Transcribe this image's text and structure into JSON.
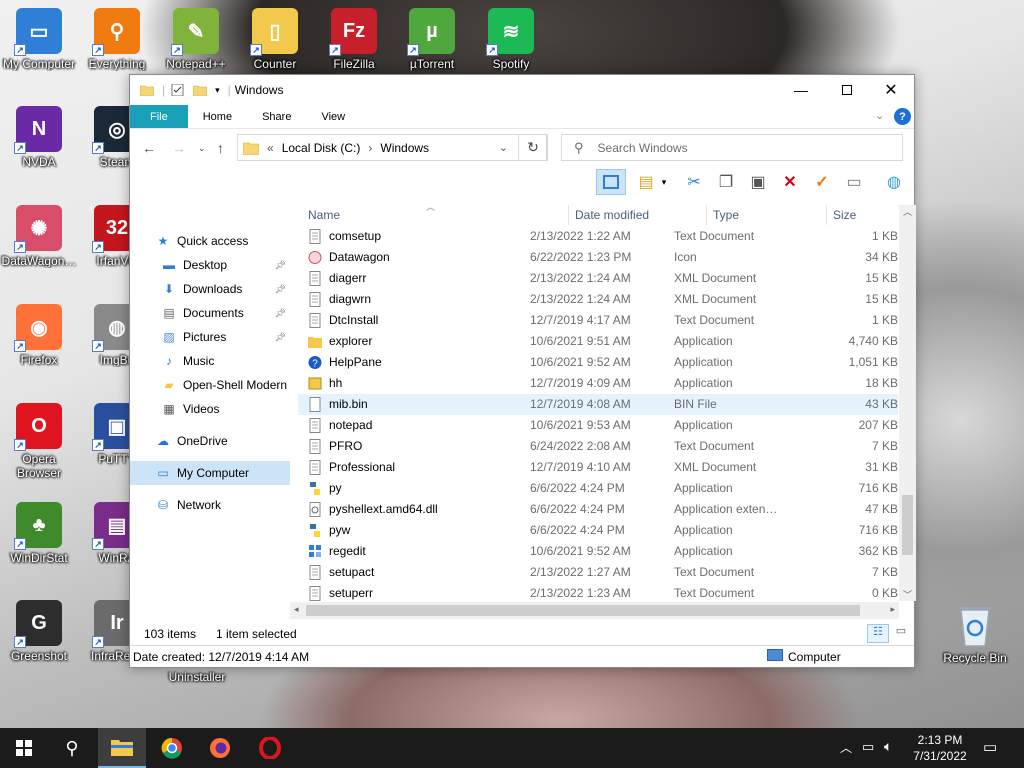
{
  "desktop": {
    "icons": [
      {
        "label": "My Computer",
        "color": "#2f7fd6",
        "glyph": "▭"
      },
      {
        "label": "Everything",
        "color": "#f07b10",
        "glyph": "⚲"
      },
      {
        "label": "Notepad++",
        "color": "#7fb33a",
        "glyph": "✎"
      },
      {
        "label": "Counter",
        "color": "#f2c94c",
        "glyph": "▯"
      },
      {
        "label": "FileZilla",
        "color": "#c8202a",
        "glyph": "Fz"
      },
      {
        "label": "µTorrent",
        "color": "#4fa83d",
        "glyph": "µ"
      },
      {
        "label": "Spotify",
        "color": "#1db954",
        "glyph": "≋"
      },
      {
        "label": "NVDA",
        "color": "#6b2aa5",
        "glyph": "N"
      },
      {
        "label": "Steam",
        "color": "#1b2838",
        "glyph": "◎"
      },
      {
        "label": "DataWagon…",
        "color": "#d94d6a",
        "glyph": "✺"
      },
      {
        "label": "IrfanVie",
        "color": "#c4161c",
        "glyph": "32"
      },
      {
        "label": "Firefox",
        "color": "#ff7139",
        "glyph": "◉"
      },
      {
        "label": "ImgBu",
        "color": "#8a8a8a",
        "glyph": "◍"
      },
      {
        "label": "Opera\nBrowser",
        "color": "#e0141e",
        "glyph": "O"
      },
      {
        "label": "PuTTY",
        "color": "#2b4fa0",
        "glyph": "▣"
      },
      {
        "label": "WinDirStat",
        "color": "#3f8a2a",
        "glyph": "♣"
      },
      {
        "label": "WinRA",
        "color": "#7a2d88",
        "glyph": "▤"
      },
      {
        "label": "Greenshot",
        "color": "#2d2d2d",
        "glyph": "G"
      },
      {
        "label": "InfraReco",
        "color": "#6b6b6b",
        "glyph": "Ir"
      }
    ],
    "floating_label": "Uninstaller",
    "recycle_bin": "Recycle Bin"
  },
  "window": {
    "title": "Windows",
    "ribbon_tabs": [
      "File",
      "Home",
      "Share",
      "View"
    ],
    "address": {
      "prefix": "«",
      "parts": [
        "Local Disk (C:)",
        "Windows"
      ]
    },
    "search_placeholder": "Search Windows",
    "nav": [
      {
        "label": "Quick access",
        "icon": "star-icon",
        "glyph": "★",
        "color": "#2f7fd6"
      },
      {
        "label": "Desktop",
        "icon": "desktop-icon",
        "glyph": "▬",
        "color": "#2f7fd6",
        "pinned": true
      },
      {
        "label": "Downloads",
        "icon": "download-icon",
        "glyph": "⬇",
        "color": "#2f7fd6",
        "pinned": true
      },
      {
        "label": "Documents",
        "icon": "document-icon",
        "glyph": "▤",
        "color": "#666666",
        "pinned": true
      },
      {
        "label": "Pictures",
        "icon": "picture-icon",
        "glyph": "▨",
        "color": "#4a8bd6",
        "pinned": true
      },
      {
        "label": "Music",
        "icon": "music-icon",
        "glyph": "♪",
        "color": "#2f7fd6"
      },
      {
        "label": "Open-Shell Modern",
        "icon": "folder-icon",
        "glyph": "▰",
        "color": "#f2c94c"
      },
      {
        "label": "Videos",
        "icon": "video-icon",
        "glyph": "▦",
        "color": "#555555"
      },
      {
        "label": "OneDrive",
        "icon": "cloud-icon",
        "glyph": "☁",
        "color": "#1a73e8"
      },
      {
        "label": "My Computer",
        "icon": "computer-icon",
        "glyph": "▭",
        "color": "#2f7fd6",
        "selected": true
      },
      {
        "label": "Network",
        "icon": "network-icon",
        "glyph": "⛁",
        "color": "#2f7fd6"
      }
    ],
    "columns": [
      "Name",
      "Date modified",
      "Type",
      "Size"
    ],
    "files": [
      {
        "name": "comsetup",
        "date": "2/13/2022 1:22 AM",
        "type": "Text Document",
        "size": "1 KB",
        "icon": "text"
      },
      {
        "name": "Datawagon",
        "date": "6/22/2022 1:23 PM",
        "type": "Icon",
        "size": "34 KB",
        "icon": "ico"
      },
      {
        "name": "diagerr",
        "date": "2/13/2022 1:24 AM",
        "type": "XML Document",
        "size": "15 KB",
        "icon": "text"
      },
      {
        "name": "diagwrn",
        "date": "2/13/2022 1:24 AM",
        "type": "XML Document",
        "size": "15 KB",
        "icon": "text"
      },
      {
        "name": "DtcInstall",
        "date": "12/7/2019 4:17 AM",
        "type": "Text Document",
        "size": "1 KB",
        "icon": "text"
      },
      {
        "name": "explorer",
        "date": "10/6/2021 9:51 AM",
        "type": "Application",
        "size": "4,740 KB",
        "icon": "folder"
      },
      {
        "name": "HelpPane",
        "date": "10/6/2021 9:52 AM",
        "type": "Application",
        "size": "1,051 KB",
        "icon": "help"
      },
      {
        "name": "hh",
        "date": "12/7/2019 4:09 AM",
        "type": "Application",
        "size": "18 KB",
        "icon": "hh"
      },
      {
        "name": "mib.bin",
        "date": "12/7/2019 4:08 AM",
        "type": "BIN File",
        "size": "43 KB",
        "icon": "blank",
        "selected": true
      },
      {
        "name": "notepad",
        "date": "10/6/2021 9:53 AM",
        "type": "Application",
        "size": "207 KB",
        "icon": "text"
      },
      {
        "name": "PFRO",
        "date": "6/24/2022 2:08 AM",
        "type": "Text Document",
        "size": "7 KB",
        "icon": "text"
      },
      {
        "name": "Professional",
        "date": "12/7/2019 4:10 AM",
        "type": "XML Document",
        "size": "31 KB",
        "icon": "text"
      },
      {
        "name": "py",
        "date": "6/6/2022 4:24 PM",
        "type": "Application",
        "size": "716 KB",
        "icon": "py"
      },
      {
        "name": "pyshellext.amd64.dll",
        "date": "6/6/2022 4:24 PM",
        "type": "Application exten…",
        "size": "47 KB",
        "icon": "dll"
      },
      {
        "name": "pyw",
        "date": "6/6/2022 4:24 PM",
        "type": "Application",
        "size": "716 KB",
        "icon": "py"
      },
      {
        "name": "regedit",
        "date": "10/6/2021 9:52 AM",
        "type": "Application",
        "size": "362 KB",
        "icon": "reg"
      },
      {
        "name": "setupact",
        "date": "2/13/2022 1:27 AM",
        "type": "Text Document",
        "size": "7 KB",
        "icon": "text"
      },
      {
        "name": "setuperr",
        "date": "2/13/2022 1:23 AM",
        "type": "Text Document",
        "size": "0 KB",
        "icon": "text"
      }
    ],
    "status": {
      "items": "103 items",
      "selected": "1 item selected"
    },
    "details": {
      "created": "Date created: 12/7/2019 4:14 AM",
      "location": "Computer"
    }
  },
  "taskbar": {
    "apps": [
      "windows-start-icon",
      "search-icon",
      "file-explorer-icon",
      "chrome-icon",
      "firefox-icon",
      "opera-icon"
    ],
    "time": "2:13 PM",
    "date": "7/31/2022"
  }
}
